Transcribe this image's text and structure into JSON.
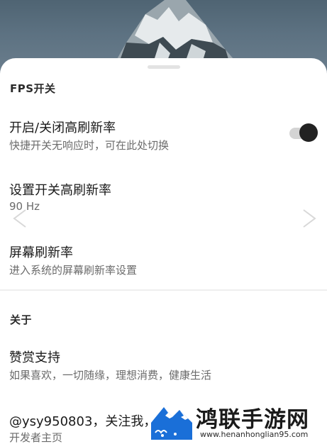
{
  "sections": {
    "fps": {
      "header": "FPS开关",
      "rows": [
        {
          "title": "开启/关闭高刷新率",
          "subtitle": "快捷开关无响应时，可在此处切换"
        },
        {
          "title": "设置开关高刷新率",
          "subtitle": "90 Hz"
        },
        {
          "title": "屏幕刷新率",
          "subtitle": "进入系统的屏幕刷新率设置"
        }
      ]
    },
    "about": {
      "header": "关于",
      "rows": [
        {
          "title": "赞赏支持",
          "subtitle": "如果喜欢，一切随缘，理想消费，健康生活"
        },
        {
          "title": "@ysy950803，关注我，",
          "subtitle": "开发者主页"
        }
      ]
    }
  },
  "toggle": {
    "state": "on"
  },
  "icons": {
    "toggle_knob": "toggle-switch",
    "left_chevron": "chevron-left-icon",
    "right_chevron": "chevron-right-icon",
    "watermark_logo": "mountain-logo-icon"
  },
  "watermark": {
    "title": "鸿联手游网",
    "url": "www.henanhonglian95.com"
  },
  "colors": {
    "toggle_track": "#d4d4d4",
    "toggle_knob": "#222222",
    "watermark_blue": "#1a6fd8"
  }
}
